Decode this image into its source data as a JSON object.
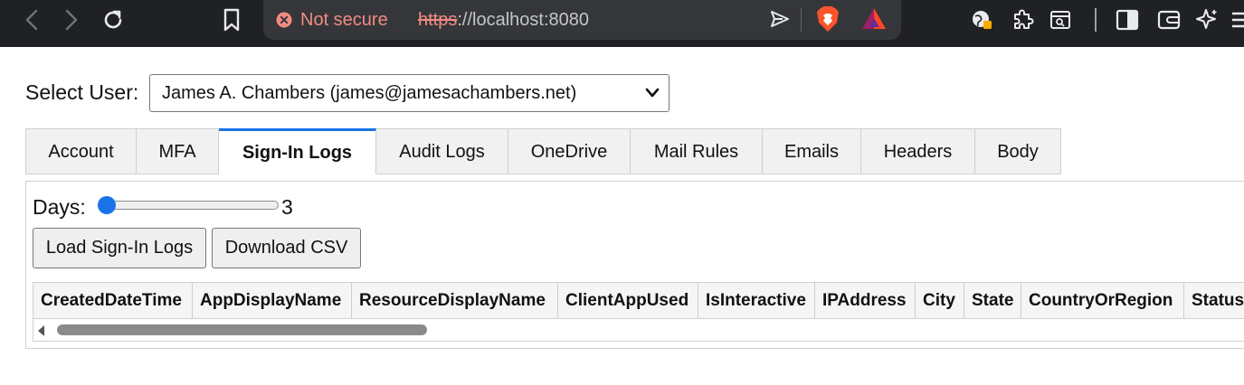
{
  "browser": {
    "security_warning": "Not secure",
    "url_scheme": "https",
    "url_rest": "://localhost:8080",
    "accent_warning": "#f28b82"
  },
  "page": {
    "select_label": "Select User:",
    "selected_user": "James A. Chambers (james@jamesachambers.net)",
    "tabs": [
      {
        "label": "Account",
        "active": false
      },
      {
        "label": "MFA",
        "active": false
      },
      {
        "label": "Sign-In Logs",
        "active": true
      },
      {
        "label": "Audit Logs",
        "active": false
      },
      {
        "label": "OneDrive",
        "active": false
      },
      {
        "label": "Mail Rules",
        "active": false
      },
      {
        "label": "Emails",
        "active": false
      },
      {
        "label": "Headers",
        "active": false
      },
      {
        "label": "Body",
        "active": false
      }
    ],
    "days_label": "Days:",
    "days_value": "3",
    "days_slider_fraction": 0.0,
    "load_button": "Load Sign-In Logs",
    "csv_button": "Download CSV",
    "columns": [
      "CreatedDateTime",
      "AppDisplayName",
      "ResourceDisplayName",
      "ClientAppUsed",
      "IsInteractive",
      "IPAddress",
      "City",
      "State",
      "CountryOrRegion",
      "Status"
    ],
    "accent_color": "#1a73e8"
  }
}
